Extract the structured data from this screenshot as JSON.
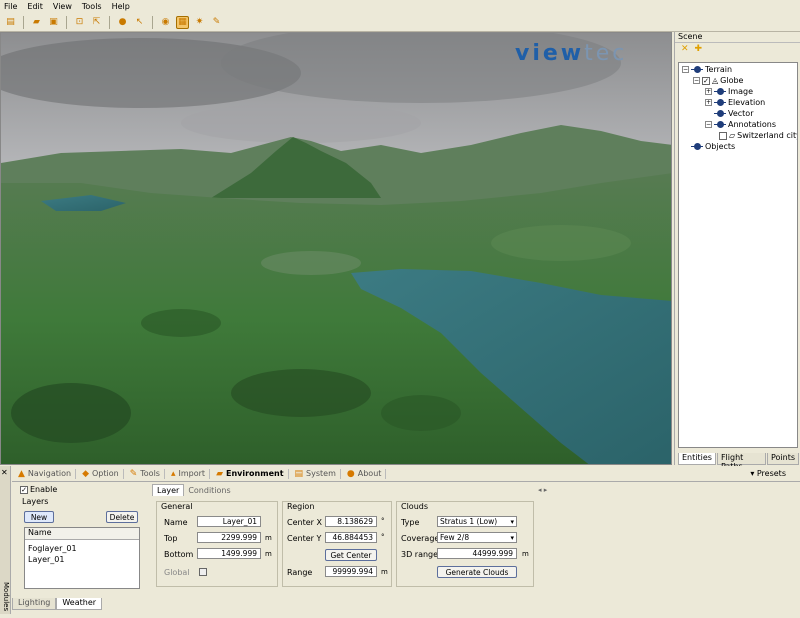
{
  "menu": [
    "File",
    "Edit",
    "View",
    "Tools",
    "Help"
  ],
  "toolbar_icons": [
    "new-icon",
    "open-icon",
    "save-icon",
    "fit-view-icon",
    "measure-icon",
    "help-icon",
    "pointer-icon",
    "globe-icon",
    "screenshot-icon",
    "sun-icon",
    "tool-icon"
  ],
  "viewport": {
    "logo_part1": "view",
    "logo_part2": "tec"
  },
  "scene": {
    "title": "Scene",
    "tree": {
      "terrain": "Terrain",
      "globe": "Globe",
      "image": "Image",
      "elevation": "Elevation",
      "vector": "Vector",
      "annotations": "Annotations",
      "switzerland": "Switzerland city",
      "objects": "Objects"
    },
    "tabs": [
      "Entities",
      "Flight Paths",
      "Points"
    ]
  },
  "modules": {
    "strip_label": "Modules",
    "tabs": [
      "Navigation",
      "Option",
      "Tools",
      "Import",
      "Environment",
      "System",
      "About"
    ],
    "presets": "Presets"
  },
  "env": {
    "enable": "Enable",
    "layers": "Layers",
    "new": "New",
    "delete": "Delete",
    "list_header": "Name",
    "list_rows": [
      "Foglayer_01",
      "Layer_01"
    ],
    "sub_tabs": [
      "Layer",
      "Conditions"
    ],
    "general": {
      "title": "General",
      "name_label": "Name",
      "name_value": "Layer_01",
      "top_label": "Top",
      "top_value": "2299.999",
      "top_unit": "m",
      "bottom_label": "Bottom",
      "bottom_value": "1499.999",
      "bottom_unit": "m",
      "global_label": "Global"
    },
    "region": {
      "title": "Region",
      "cx_label": "Center X",
      "cx_value": "8.138629",
      "cx_unit": "°",
      "cy_label": "Center Y",
      "cy_value": "46.884453",
      "cy_unit": "°",
      "get_center": "Get Center",
      "range_label": "Range",
      "range_value": "99999.994",
      "range_unit": "m"
    },
    "clouds": {
      "title": "Clouds",
      "type_label": "Type",
      "type_value": "Stratus 1 (Low)",
      "coverage_label": "Coverage",
      "coverage_value": "Few 2/8",
      "range_label": "3D range",
      "range_value": "44999.999",
      "range_unit": "m",
      "generate": "Generate Clouds"
    }
  },
  "bottom_tabs": [
    "Lighting",
    "Weather"
  ]
}
